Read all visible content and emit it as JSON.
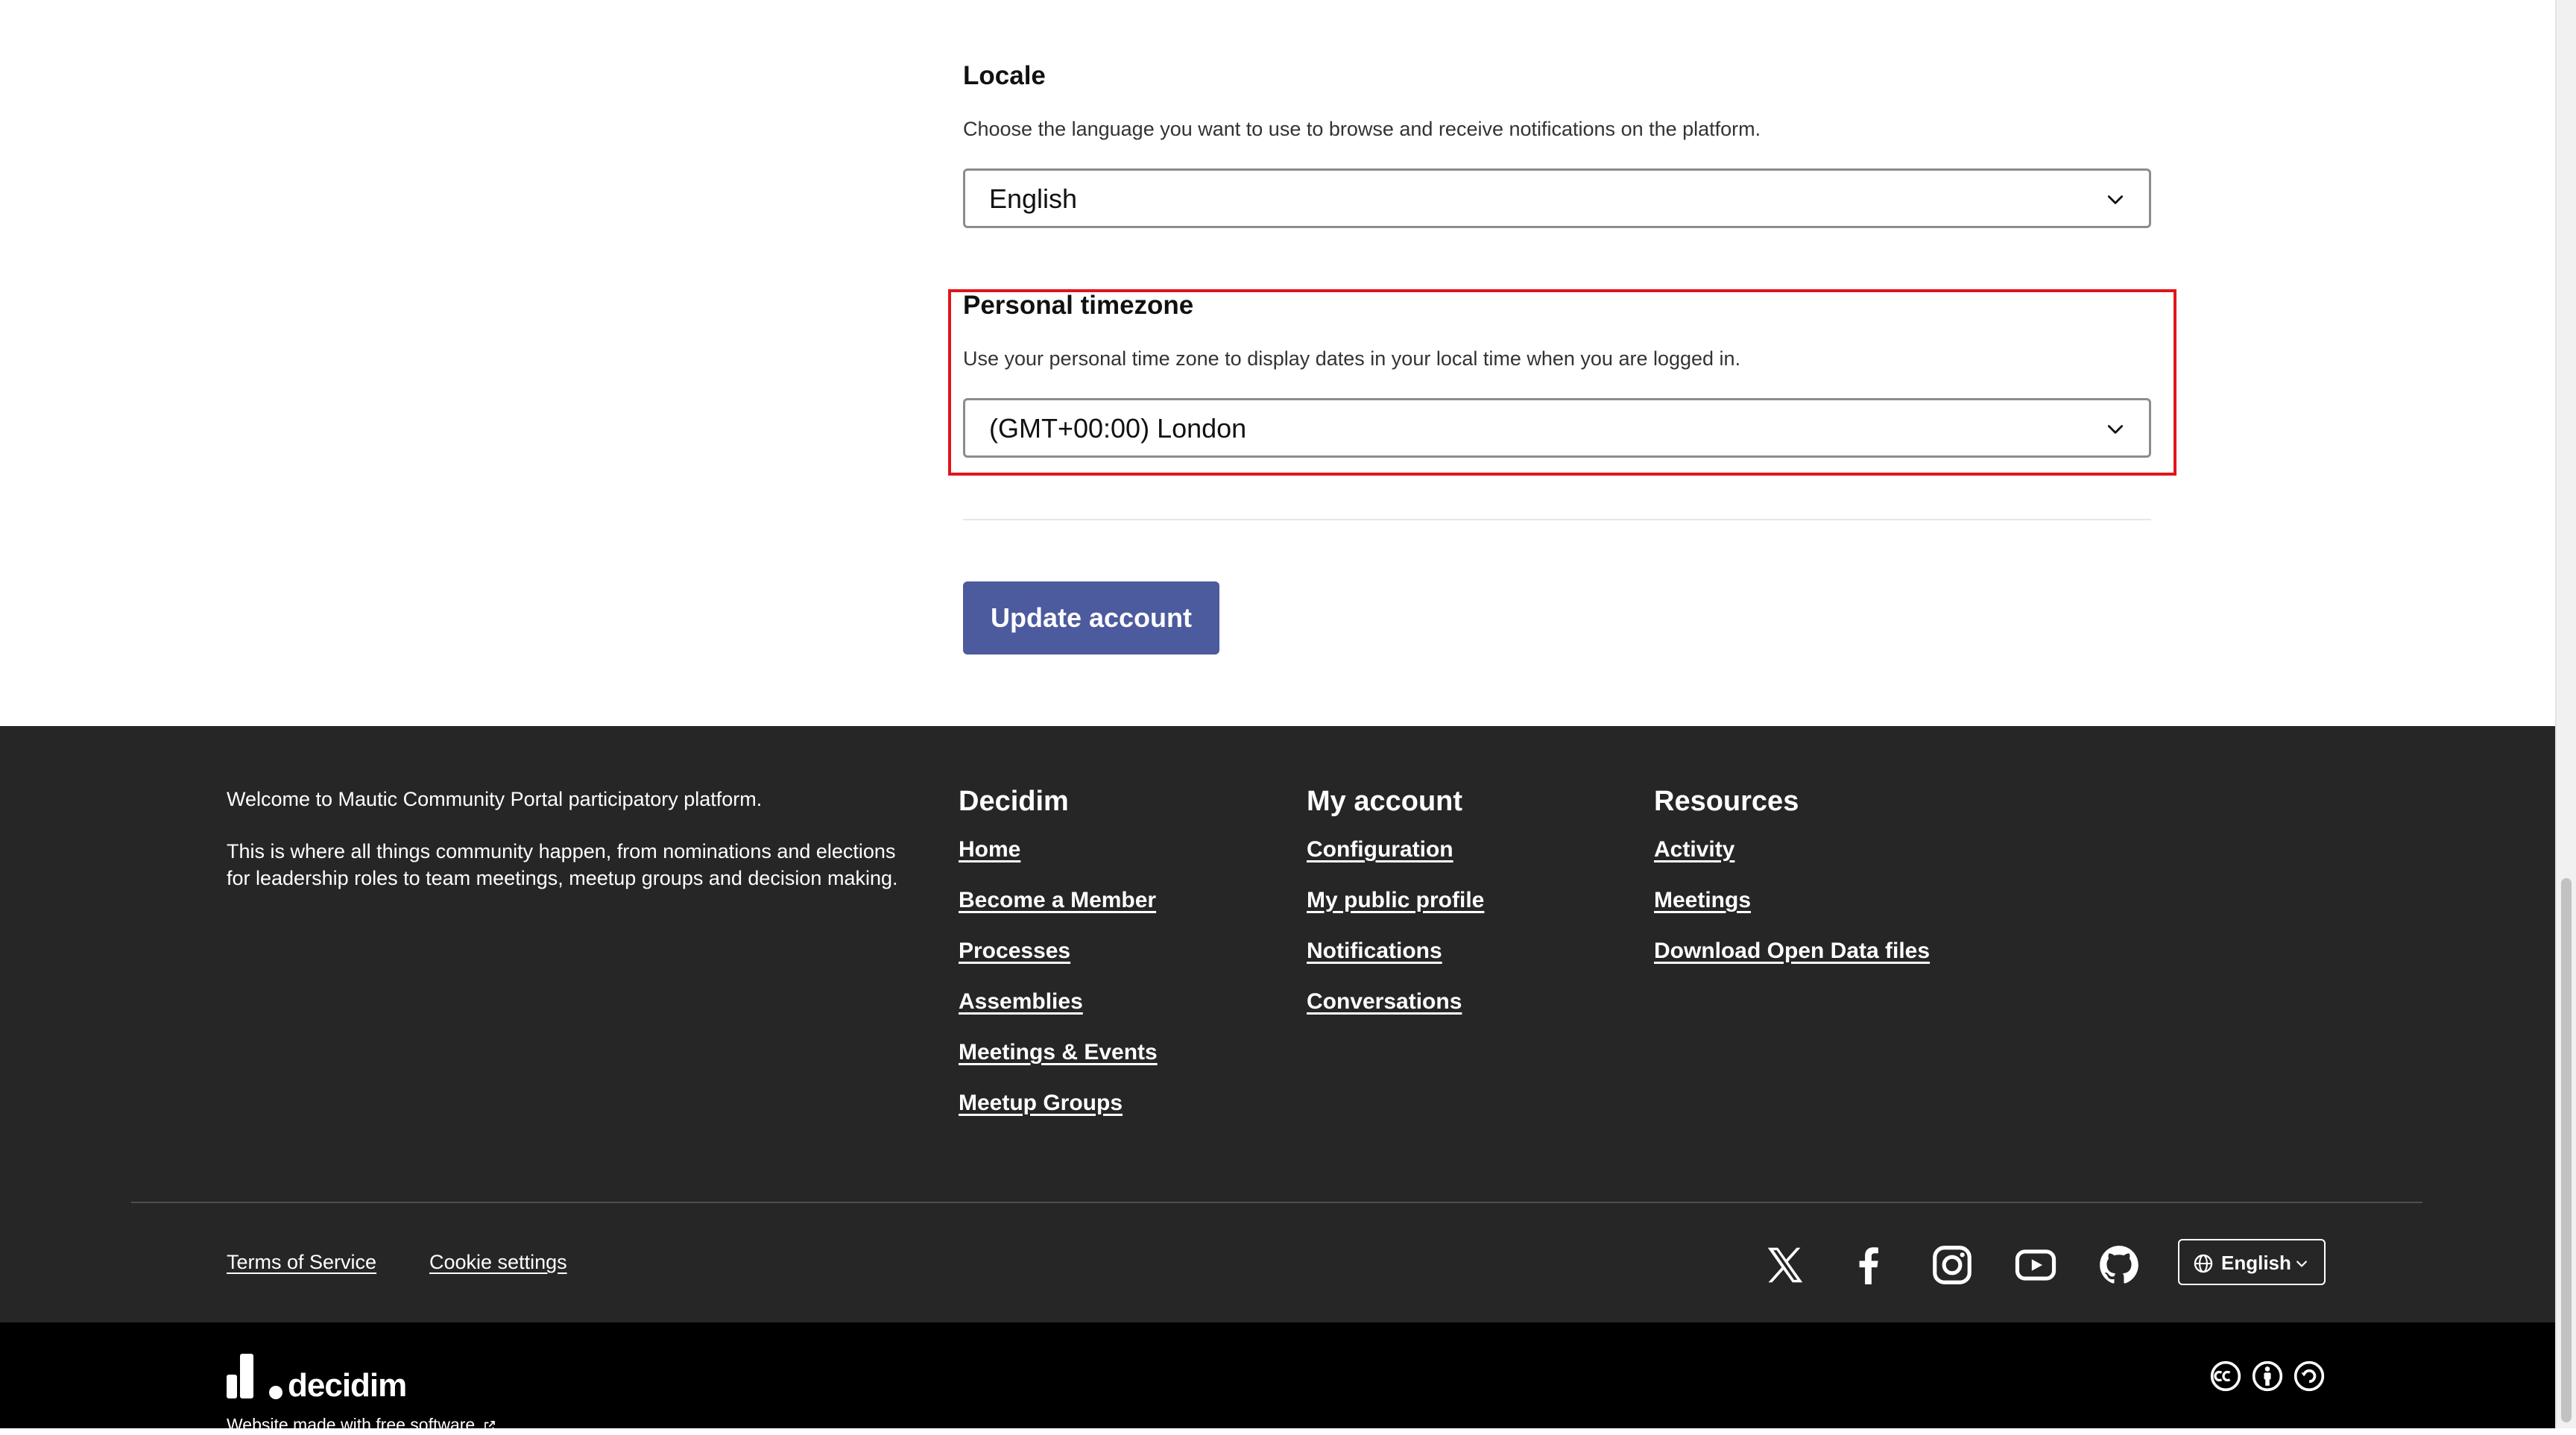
{
  "form": {
    "locale": {
      "title": "Locale",
      "help": "Choose the language you want to use to browse and receive notifications on the platform.",
      "value": "English"
    },
    "timezone": {
      "title": "Personal timezone",
      "help": "Use your personal time zone to display dates in your local time when you are logged in.",
      "value": "(GMT+00:00) London"
    },
    "submit_label": "Update account"
  },
  "footer": {
    "intro": [
      "Welcome to Mautic Community Portal participatory platform.",
      "This is where all things community happen, from nominations and elections for leadership roles to team meetings, meetup groups and decision making."
    ],
    "columns": [
      {
        "title": "Decidim",
        "links": [
          "Home",
          "Become a Member",
          "Processes",
          "Assemblies",
          "Meetings & Events",
          "Meetup Groups"
        ]
      },
      {
        "title": "My account",
        "links": [
          "Configuration",
          "My public profile",
          "Notifications",
          "Conversations"
        ]
      },
      {
        "title": "Resources",
        "links": [
          "Activity",
          "Meetings",
          "Download Open Data files"
        ]
      }
    ],
    "legal_links": [
      "Terms of Service",
      "Cookie settings"
    ],
    "social_icons": [
      "x-icon",
      "facebook-icon",
      "instagram-icon",
      "youtube-icon",
      "github-icon"
    ],
    "language_label": "English"
  },
  "bottom": {
    "logo_text": "decidim",
    "made_with": "Website made with free software",
    "license_icons": [
      "creative-commons-icon",
      "attribution-icon",
      "share-alike-icon"
    ]
  },
  "colors": {
    "accent_button": "#4c5a9e",
    "highlight_border": "#e2141b",
    "footer_bg": "#262626",
    "bottom_bg": "#000000"
  }
}
